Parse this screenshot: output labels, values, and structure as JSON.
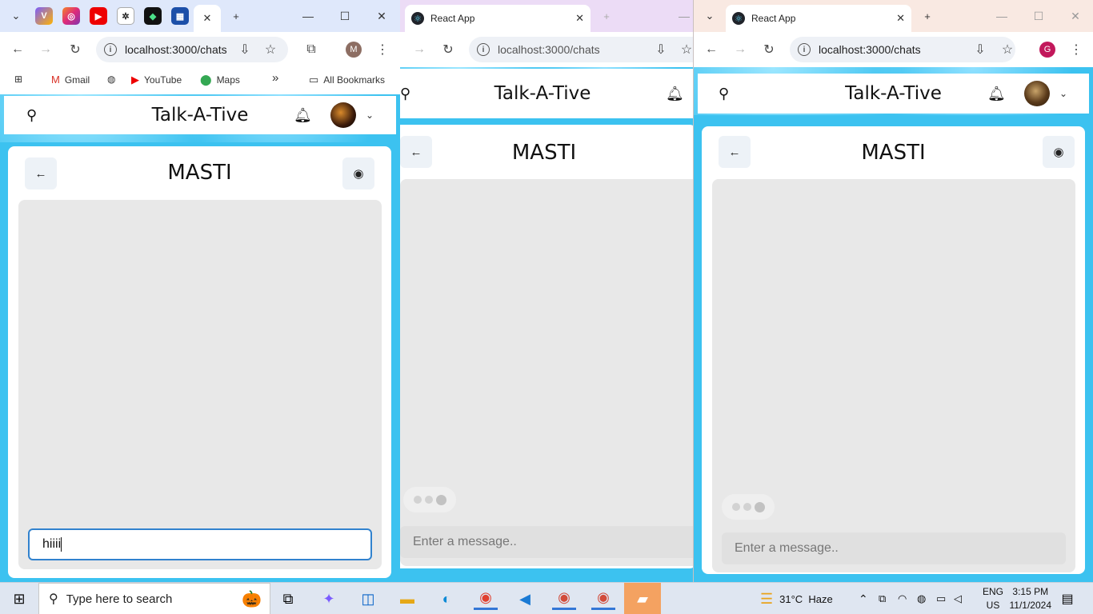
{
  "windows": [
    {
      "id": "win1",
      "tabs": [
        {
          "title": "",
          "close": "✕"
        }
      ],
      "new_tab": "+",
      "url": "localhost:3000/chats",
      "profile_letter": "M",
      "bookmarks": [
        {
          "label": "Gmail",
          "icon": "gmail-icon"
        },
        {
          "label": "YouTube",
          "icon": "youtube-icon"
        },
        {
          "label": "Maps",
          "icon": "maps-icon"
        }
      ],
      "bookmarks_more": "»",
      "all_bookmarks": "All Bookmarks",
      "app": {
        "brand": "Talk-A-Tive",
        "chat_name": "MASTI",
        "input_value": "hiiii",
        "input_placeholder": "Enter a message.."
      }
    },
    {
      "id": "win2",
      "tabs": [
        {
          "title": "React App",
          "close": "✕"
        }
      ],
      "new_tab": "+",
      "url": "localhost:3000/chats",
      "app": {
        "brand": "Talk-A-Tive",
        "chat_name": "MASTI",
        "input_placeholder": "Enter a message.."
      }
    },
    {
      "id": "win3",
      "tabs": [
        {
          "title": "React App",
          "close": "✕"
        }
      ],
      "new_tab": "+",
      "url": "localhost:3000/chats",
      "profile_letter": "G",
      "app": {
        "brand": "Talk-A-Tive",
        "chat_name": "MASTI",
        "input_placeholder": "Enter a message.."
      }
    }
  ],
  "taskbar": {
    "search_placeholder": "Type here to search",
    "weather": "31°C  Haze",
    "lang_top": "ENG",
    "lang_bottom": "US",
    "time": "3:15 PM",
    "date": "11/1/2024",
    "apps": [
      "task-view-icon",
      "copilot-icon",
      "outlook-icon",
      "file-explorer-icon",
      "edge-icon",
      "chrome-icon",
      "vscode-icon",
      "chrome-profile-icon",
      "chrome-profile-2-icon",
      "folder-icon"
    ]
  },
  "colors": {
    "app_background": "#3cc2f0",
    "message_area": "#e8e8e8",
    "input_focus_border": "#3182ce"
  }
}
